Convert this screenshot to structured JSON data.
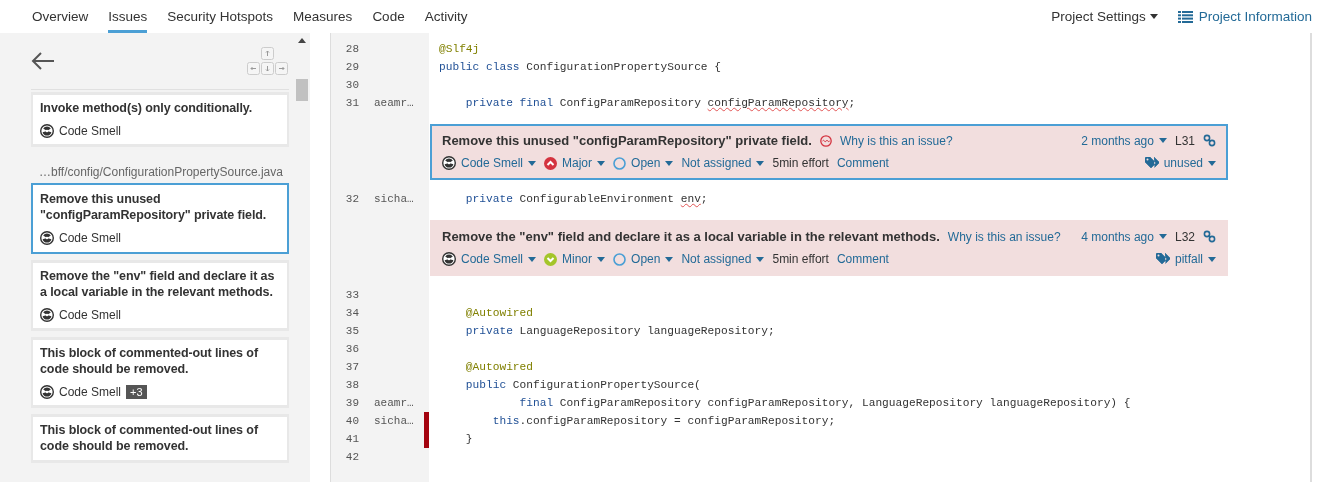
{
  "nav": {
    "tabs": [
      {
        "label": "Overview",
        "selected": false
      },
      {
        "label": "Issues",
        "selected": true
      },
      {
        "label": "Security Hotspots",
        "selected": false
      },
      {
        "label": "Measures",
        "selected": false
      },
      {
        "label": "Code",
        "selected": false
      },
      {
        "label": "Activity",
        "selected": false
      }
    ],
    "settings": "Project Settings",
    "information": "Project Information"
  },
  "sidebar": {
    "items": [
      {
        "kind": "card",
        "title": "Invoke method(s) only conditionally.",
        "type": "Code Smell",
        "selected": false
      },
      {
        "kind": "path",
        "text": "…bff/config/ConfigurationPropertySource.java"
      },
      {
        "kind": "card",
        "title": "Remove this unused \"configParamRepository\" private field.",
        "type": "Code Smell",
        "selected": true
      },
      {
        "kind": "card",
        "title": "Remove the \"env\" field and declare it as a local variable in the relevant methods.",
        "type": "Code Smell",
        "selected": false
      },
      {
        "kind": "card",
        "title": "This block of commented-out lines of code should be removed.",
        "type": "Code Smell",
        "extra": "+3",
        "selected": false
      },
      {
        "kind": "card",
        "title": "This block of commented-out lines of code should be removed.",
        "selected": false
      }
    ]
  },
  "code": [
    {
      "kind": "line",
      "number": "28",
      "marked": false,
      "code": [
        {
          "text": "@Slf4j",
          "kind": "annotation"
        }
      ]
    },
    {
      "kind": "line",
      "number": "29",
      "marked": false,
      "code": [
        {
          "text": "public ",
          "kind": "keyword"
        },
        {
          "text": "class",
          "kind": "keyword"
        },
        {
          "text": " ConfigurationPropertySource {",
          "kind": "plain"
        }
      ]
    },
    {
      "kind": "line",
      "number": "30",
      "marked": false
    },
    {
      "kind": "line",
      "number": "31",
      "author": "aeamr…",
      "marked": false,
      "code": [
        {
          "text": "    private ",
          "kind": "keyword"
        },
        {
          "text": "final",
          "kind": "keyword"
        },
        {
          "text": " ConfigParamRepository ",
          "kind": "plain"
        },
        {
          "text": "configParamRepository",
          "kind": "issue"
        },
        {
          "text": ";",
          "kind": "plain"
        }
      ]
    },
    {
      "kind": "issue",
      "message": "Remove this unused \"configParamRepository\" private field.",
      "source_icon": true,
      "why": "Why is this an issue?",
      "age": "2 months ago",
      "line": "L31",
      "type": "Code Smell",
      "severity": "Major",
      "high_severity": true,
      "status": "Open",
      "assignee": "Not assigned",
      "effort": "5min effort",
      "comment": "Comment",
      "tag": "unused",
      "selected": true
    },
    {
      "kind": "line",
      "number": "32",
      "author": "sicha…",
      "marked": false,
      "code": [
        {
          "text": "    private",
          "kind": "keyword"
        },
        {
          "text": " ConfigurableEnvironment ",
          "kind": "plain"
        },
        {
          "text": "env",
          "kind": "issue"
        },
        {
          "text": ";",
          "kind": "plain"
        }
      ]
    },
    {
      "kind": "issue",
      "message": "Remove the \"env\" field and declare it as a local variable in the relevant methods.",
      "source_icon": false,
      "why": "Why is this an issue?",
      "age": "4 months ago",
      "line": "L32",
      "type": "Code Smell",
      "severity": "Minor",
      "high_severity": false,
      "status": "Open",
      "assignee": "Not assigned",
      "effort": "5min effort",
      "comment": "Comment",
      "tag": "pitfall",
      "selected": false
    },
    {
      "kind": "line",
      "number": "33",
      "marked": false
    },
    {
      "kind": "line",
      "number": "34",
      "marked": false,
      "code": [
        {
          "text": "    @Autowired",
          "kind": "annotation"
        }
      ]
    },
    {
      "kind": "line",
      "number": "35",
      "marked": false,
      "code": [
        {
          "text": "    private",
          "kind": "keyword"
        },
        {
          "text": " LanguageRepository languageRepository;",
          "kind": "plain"
        }
      ]
    },
    {
      "kind": "line",
      "number": "36",
      "marked": false
    },
    {
      "kind": "line",
      "number": "37",
      "marked": false,
      "code": [
        {
          "text": "    @Autowired",
          "kind": "annotation"
        }
      ]
    },
    {
      "kind": "line",
      "number": "38",
      "marked": false,
      "code": [
        {
          "text": "    public",
          "kind": "keyword"
        },
        {
          "text": " ConfigurationPropertySource(",
          "kind": "plain"
        }
      ]
    },
    {
      "kind": "line",
      "number": "39",
      "author": "aeamr…",
      "marked": false,
      "code": [
        {
          "text": "            final",
          "kind": "keyword"
        },
        {
          "text": " ConfigParamRepository configParamRepository, LanguageRepository languageRepository) {",
          "kind": "plain"
        }
      ]
    },
    {
      "kind": "line",
      "number": "40",
      "author": "sicha…",
      "marked": true,
      "code": [
        {
          "text": "        this",
          "kind": "keyword"
        },
        {
          "text": ".configParamRepository = configParamRepository;",
          "kind": "plain"
        }
      ]
    },
    {
      "kind": "line",
      "number": "41",
      "marked": true,
      "code": [
        {
          "text": "    }",
          "kind": "plain"
        }
      ]
    },
    {
      "kind": "line",
      "number": "42",
      "marked": false
    }
  ]
}
